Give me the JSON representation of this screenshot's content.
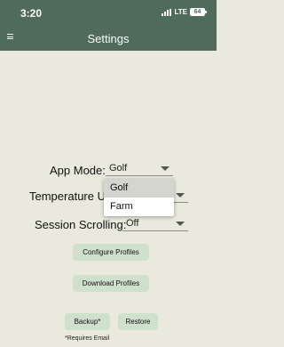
{
  "status_bar": {
    "time": "3:20",
    "network": "LTE",
    "battery": "64"
  },
  "app_bar": {
    "title": "Settings",
    "menu_icon": "hamburger-menu-icon"
  },
  "settings": {
    "app_mode": {
      "label": "App Mode:",
      "value": "Golf"
    },
    "temperature_units": {
      "label": "Temperature Un"
    },
    "session_scrolling": {
      "label": "Session Scrolling:",
      "value": "Off"
    }
  },
  "dropdown": {
    "options": [
      "Golf",
      "Farm"
    ],
    "selected": "Golf"
  },
  "buttons": {
    "configure_profiles": "Configure Profiles",
    "download_profiles": "Download Profiles",
    "backup": "Backup*",
    "restore": "Restore"
  },
  "footnote": "*Requires Email",
  "colors": {
    "header": "#4f6b5a",
    "background": "#e9e9dd",
    "button": "#cfe0cd"
  }
}
